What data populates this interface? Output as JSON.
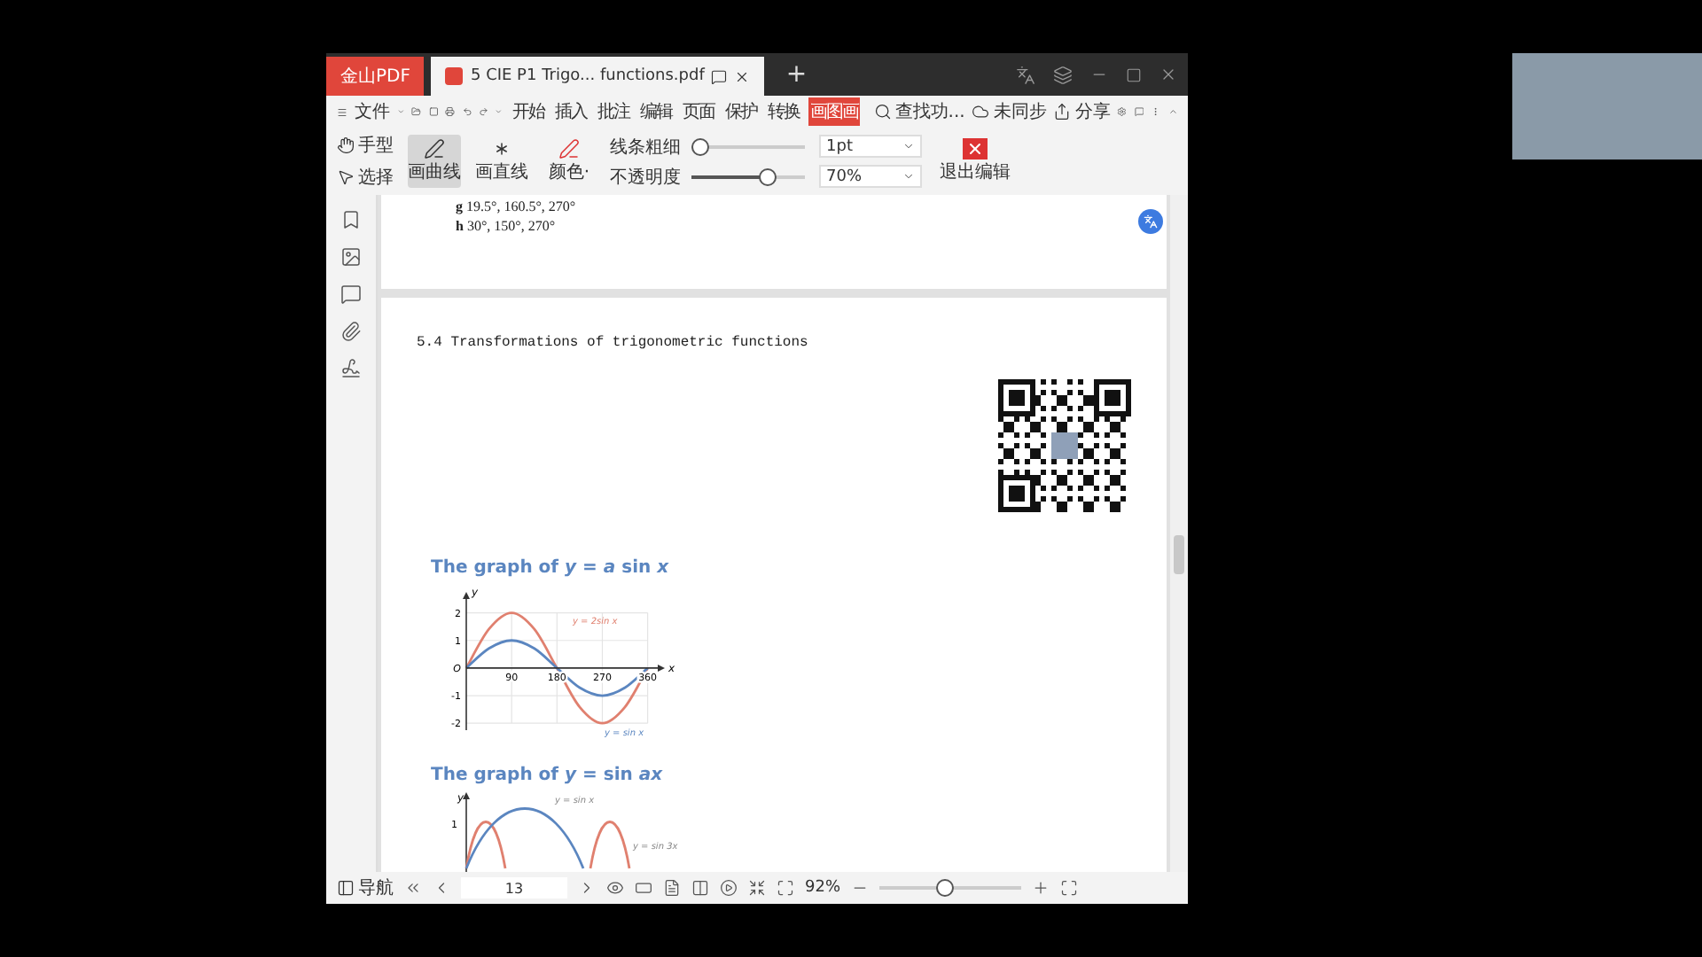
{
  "window": {
    "app_tab": "金山PDF",
    "doc_tab": "5 CIE P1 Trigo... functions.pdf",
    "new_tab": "+"
  },
  "menu": {
    "file": "文件",
    "tabs": [
      {
        "label": "开始",
        "selected": false
      },
      {
        "label": "插入",
        "selected": false
      },
      {
        "label": "批注",
        "selected": false
      },
      {
        "label": "编辑",
        "selected": false
      },
      {
        "label": "页面",
        "selected": false
      },
      {
        "label": "保护",
        "selected": false
      },
      {
        "label": "转换",
        "selected": false
      },
      {
        "label": "画图画",
        "selected": true
      }
    ],
    "search": "查找功...",
    "sync": "未同步",
    "share": "分享"
  },
  "tools": {
    "hand": "手型",
    "select": "选择",
    "draw_tools": [
      {
        "label": "画曲线",
        "kind": "curve",
        "selected": true
      },
      {
        "label": "画直线",
        "kind": "line",
        "selected": false
      }
    ],
    "color_button": "颜色·",
    "thickness": {
      "label": "线条粗细",
      "level": 0,
      "value": "1pt"
    },
    "opacity": {
      "label": "不透明度",
      "level": 0.7,
      "value": "70%"
    },
    "exit": "退出编辑"
  },
  "document": {
    "answers": [
      {
        "letter": "g",
        "text": "19.5°, 160.5°, 270°"
      },
      {
        "letter": "h",
        "text": "30°, 150°, 270°"
      }
    ],
    "heading": "5.4 Transformations of trigonometric functions",
    "graph1": {
      "title": "The graph of *y* = *a* sin *x*",
      "chart_data": {
        "type": "line",
        "xlabel": "x",
        "ylabel": "y",
        "x": [
          0,
          45,
          90,
          135,
          180,
          225,
          270,
          315,
          360
        ],
        "series": [
          {
            "name": "y = 2sin x",
            "color": "#e0806f",
            "values": [
              0,
              1.41,
              2,
              1.41,
              0,
              -1.41,
              -2,
              -1.41,
              0
            ]
          },
          {
            "name": "y = sin x",
            "color": "#5b86c0",
            "values": [
              0,
              0.71,
              1,
              0.71,
              0,
              -0.71,
              -1,
              -0.71,
              0
            ]
          }
        ],
        "grid": true,
        "xlim": [
          0,
          380
        ],
        "ylim": [
          -2.25,
          2.5
        ],
        "xticks": [
          90,
          180,
          270,
          360
        ],
        "yticks": [
          -2,
          -1,
          {
            "value": 0,
            "label": "O"
          },
          1,
          2
        ]
      }
    },
    "graph2": {
      "title": "The graph of *y* = sin *ax*",
      "axis": "y",
      "tick": "1",
      "labels": [
        "y = sin x",
        "y = sin 3x"
      ]
    }
  },
  "status_bar": {
    "nav": "导航",
    "page": "13",
    "zoom": {
      "label": "92%",
      "level": 0.45
    }
  }
}
